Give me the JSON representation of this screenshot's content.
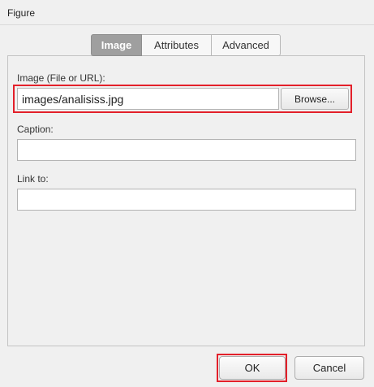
{
  "window": {
    "title": "Figure"
  },
  "tabs": [
    {
      "label": "Image",
      "active": true
    },
    {
      "label": "Attributes",
      "active": false
    },
    {
      "label": "Advanced",
      "active": false
    }
  ],
  "image_field": {
    "label": "Image (File or URL):",
    "value": "images/analisiss.jpg",
    "browse_label": "Browse..."
  },
  "caption_field": {
    "label": "Caption:",
    "value": ""
  },
  "link_field": {
    "label": "Link to:",
    "value": ""
  },
  "footer": {
    "ok_label": "OK",
    "cancel_label": "Cancel"
  },
  "colors": {
    "highlight": "#e3202a",
    "active_tab": "#9f9f9f"
  }
}
